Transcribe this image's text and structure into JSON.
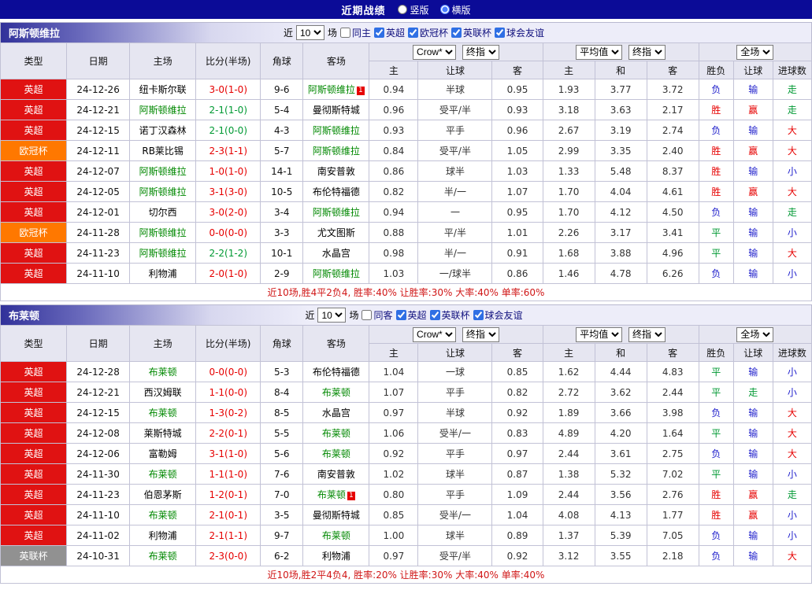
{
  "topbar": {
    "title": "近期战绩",
    "radios": [
      {
        "label": "竖版",
        "checked": false
      },
      {
        "label": "横版",
        "checked": true
      }
    ]
  },
  "palette": {
    "red": "#e60000",
    "green": "#009933",
    "blue": "#2121cc",
    "featured_team": "#008800",
    "league": {
      "英超": "#e01212",
      "欧冠杯": "#ff7800",
      "英联杯": "#919191"
    }
  },
  "red_card_badge": "1",
  "sections": [
    {
      "team": "阿斯顿维拉",
      "filter": {
        "prefix": "近",
        "count": "10",
        "suffix": "场",
        "checkboxes": [
          {
            "label": "同主",
            "checked": false
          },
          {
            "label": "英超",
            "checked": true
          },
          {
            "label": "欧冠杯",
            "checked": true
          },
          {
            "label": "英联杯",
            "checked": true
          },
          {
            "label": "球会友谊",
            "checked": true
          }
        ]
      },
      "header": {
        "cols": [
          "类型",
          "日期",
          "主场",
          "比分(半场)",
          "角球",
          "客场"
        ],
        "odds_select": "Crow*",
        "odds_stage_select": "终指",
        "odds_subcols": [
          "主",
          "让球",
          "客"
        ],
        "avg_select": "平均值",
        "avg_stage_select": "终指",
        "avg_subcols": [
          "主",
          "和",
          "客"
        ],
        "result_select": "全场",
        "result_subcols": [
          "胜负",
          "让球",
          "进球数"
        ]
      },
      "rows": [
        {
          "league": "英超",
          "date": "24-12-26",
          "home": "纽卡斯尔联",
          "score": "3-0(1-0)",
          "score_color": "red",
          "corners": "9-6",
          "away": "阿斯顿维拉",
          "away_featured": true,
          "away_red_card": true,
          "odds_home": "0.94",
          "handicap": "半球",
          "odds_away": "0.95",
          "avg_home": "1.93",
          "avg_draw": "3.77",
          "avg_away": "3.72",
          "result": "负",
          "result_color": "blue",
          "handicap_result": "输",
          "handicap_result_color": "blue",
          "goals": "走",
          "goals_color": "green"
        },
        {
          "league": "英超",
          "date": "24-12-21",
          "home": "阿斯顿维拉",
          "home_featured": true,
          "score": "2-1(1-0)",
          "score_color": "green",
          "corners": "5-4",
          "away": "曼彻斯特城",
          "odds_home": "0.96",
          "handicap": "受平/半",
          "odds_away": "0.93",
          "avg_home": "3.18",
          "avg_draw": "3.63",
          "avg_away": "2.17",
          "result": "胜",
          "result_color": "red",
          "handicap_result": "赢",
          "handicap_result_color": "red",
          "goals": "走",
          "goals_color": "green"
        },
        {
          "league": "英超",
          "date": "24-12-15",
          "home": "诺丁汉森林",
          "score": "2-1(0-0)",
          "score_color": "green",
          "corners": "4-3",
          "away": "阿斯顿维拉",
          "away_featured": true,
          "odds_home": "0.93",
          "handicap": "平手",
          "odds_away": "0.96",
          "avg_home": "2.67",
          "avg_draw": "3.19",
          "avg_away": "2.74",
          "result": "负",
          "result_color": "blue",
          "handicap_result": "输",
          "handicap_result_color": "blue",
          "goals": "大",
          "goals_color": "red"
        },
        {
          "league": "欧冠杯",
          "date": "24-12-11",
          "home": "RB莱比锡",
          "score": "2-3(1-1)",
          "score_color": "red",
          "corners": "5-7",
          "away": "阿斯顿维拉",
          "away_featured": true,
          "odds_home": "0.84",
          "handicap": "受平/半",
          "odds_away": "1.05",
          "avg_home": "2.99",
          "avg_draw": "3.35",
          "avg_away": "2.40",
          "result": "胜",
          "result_color": "red",
          "handicap_result": "赢",
          "handicap_result_color": "red",
          "goals": "大",
          "goals_color": "red"
        },
        {
          "league": "英超",
          "date": "24-12-07",
          "home": "阿斯顿维拉",
          "home_featured": true,
          "score": "1-0(1-0)",
          "score_color": "red",
          "corners": "14-1",
          "away": "南安普敦",
          "odds_home": "0.86",
          "handicap": "球半",
          "odds_away": "1.03",
          "avg_home": "1.33",
          "avg_draw": "5.48",
          "avg_away": "8.37",
          "result": "胜",
          "result_color": "red",
          "handicap_result": "输",
          "handicap_result_color": "blue",
          "goals": "小",
          "goals_color": "blue"
        },
        {
          "league": "英超",
          "date": "24-12-05",
          "home": "阿斯顿维拉",
          "home_featured": true,
          "score": "3-1(3-0)",
          "score_color": "red",
          "corners": "10-5",
          "away": "布伦特福德",
          "odds_home": "0.82",
          "handicap": "半/一",
          "odds_away": "1.07",
          "avg_home": "1.70",
          "avg_draw": "4.04",
          "avg_away": "4.61",
          "result": "胜",
          "result_color": "red",
          "handicap_result": "赢",
          "handicap_result_color": "red",
          "goals": "大",
          "goals_color": "red"
        },
        {
          "league": "英超",
          "date": "24-12-01",
          "home": "切尔西",
          "score": "3-0(2-0)",
          "score_color": "red",
          "corners": "3-4",
          "away": "阿斯顿维拉",
          "away_featured": true,
          "odds_home": "0.94",
          "handicap": "一",
          "odds_away": "0.95",
          "avg_home": "1.70",
          "avg_draw": "4.12",
          "avg_away": "4.50",
          "result": "负",
          "result_color": "blue",
          "handicap_result": "输",
          "handicap_result_color": "blue",
          "goals": "走",
          "goals_color": "green"
        },
        {
          "league": "欧冠杯",
          "date": "24-11-28",
          "home": "阿斯顿维拉",
          "home_featured": true,
          "score": "0-0(0-0)",
          "score_color": "red",
          "corners": "3-3",
          "away": "尤文图斯",
          "odds_home": "0.88",
          "handicap": "平/半",
          "odds_away": "1.01",
          "avg_home": "2.26",
          "avg_draw": "3.17",
          "avg_away": "3.41",
          "result": "平",
          "result_color": "green",
          "handicap_result": "输",
          "handicap_result_color": "blue",
          "goals": "小",
          "goals_color": "blue"
        },
        {
          "league": "英超",
          "date": "24-11-23",
          "home": "阿斯顿维拉",
          "home_featured": true,
          "score": "2-2(1-2)",
          "score_color": "green",
          "corners": "10-1",
          "away": "水晶宫",
          "odds_home": "0.98",
          "handicap": "半/一",
          "odds_away": "0.91",
          "avg_home": "1.68",
          "avg_draw": "3.88",
          "avg_away": "4.96",
          "result": "平",
          "result_color": "green",
          "handicap_result": "输",
          "handicap_result_color": "blue",
          "goals": "大",
          "goals_color": "red"
        },
        {
          "league": "英超",
          "date": "24-11-10",
          "home": "利物浦",
          "score": "2-0(1-0)",
          "score_color": "red",
          "corners": "2-9",
          "away": "阿斯顿维拉",
          "away_featured": true,
          "odds_home": "1.03",
          "handicap": "一/球半",
          "odds_away": "0.86",
          "avg_home": "1.46",
          "avg_draw": "4.78",
          "avg_away": "6.26",
          "result": "负",
          "result_color": "blue",
          "handicap_result": "输",
          "handicap_result_color": "blue",
          "goals": "小",
          "goals_color": "blue"
        }
      ],
      "summary": "近10场,胜4平2负4, 胜率:40% 让胜率:30% 大率:40% 单率:60%"
    },
    {
      "team": "布莱顿",
      "filter": {
        "prefix": "近",
        "count": "10",
        "suffix": "场",
        "checkboxes": [
          {
            "label": "同客",
            "checked": false
          },
          {
            "label": "英超",
            "checked": true
          },
          {
            "label": "英联杯",
            "checked": true
          },
          {
            "label": "球会友谊",
            "checked": true
          }
        ]
      },
      "header": {
        "cols": [
          "类型",
          "日期",
          "主场",
          "比分(半场)",
          "角球",
          "客场"
        ],
        "odds_select": "Crow*",
        "odds_stage_select": "终指",
        "odds_subcols": [
          "主",
          "让球",
          "客"
        ],
        "avg_select": "平均值",
        "avg_stage_select": "终指",
        "avg_subcols": [
          "主",
          "和",
          "客"
        ],
        "result_select": "全场",
        "result_subcols": [
          "胜负",
          "让球",
          "进球数"
        ]
      },
      "rows": [
        {
          "league": "英超",
          "date": "24-12-28",
          "home": "布莱顿",
          "home_featured": true,
          "score": "0-0(0-0)",
          "score_color": "red",
          "corners": "5-3",
          "away": "布伦特福德",
          "odds_home": "1.04",
          "handicap": "一球",
          "odds_away": "0.85",
          "avg_home": "1.62",
          "avg_draw": "4.44",
          "avg_away": "4.83",
          "result": "平",
          "result_color": "green",
          "handicap_result": "输",
          "handicap_result_color": "blue",
          "goals": "小",
          "goals_color": "blue"
        },
        {
          "league": "英超",
          "date": "24-12-21",
          "home": "西汉姆联",
          "score": "1-1(0-0)",
          "score_color": "red",
          "corners": "8-4",
          "away": "布莱顿",
          "away_featured": true,
          "odds_home": "1.07",
          "handicap": "平手",
          "odds_away": "0.82",
          "avg_home": "2.72",
          "avg_draw": "3.62",
          "avg_away": "2.44",
          "result": "平",
          "result_color": "green",
          "handicap_result": "走",
          "handicap_result_color": "green",
          "goals": "小",
          "goals_color": "blue"
        },
        {
          "league": "英超",
          "date": "24-12-15",
          "home": "布莱顿",
          "home_featured": true,
          "score": "1-3(0-2)",
          "score_color": "red",
          "corners": "8-5",
          "away": "水晶宫",
          "odds_home": "0.97",
          "handicap": "半球",
          "odds_away": "0.92",
          "avg_home": "1.89",
          "avg_draw": "3.66",
          "avg_away": "3.98",
          "result": "负",
          "result_color": "blue",
          "handicap_result": "输",
          "handicap_result_color": "blue",
          "goals": "大",
          "goals_color": "red"
        },
        {
          "league": "英超",
          "date": "24-12-08",
          "home": "莱斯特城",
          "score": "2-2(0-1)",
          "score_color": "red",
          "corners": "5-5",
          "away": "布莱顿",
          "away_featured": true,
          "odds_home": "1.06",
          "handicap": "受半/一",
          "odds_away": "0.83",
          "avg_home": "4.89",
          "avg_draw": "4.20",
          "avg_away": "1.64",
          "result": "平",
          "result_color": "green",
          "handicap_result": "输",
          "handicap_result_color": "blue",
          "goals": "大",
          "goals_color": "red"
        },
        {
          "league": "英超",
          "date": "24-12-06",
          "home": "富勒姆",
          "score": "3-1(1-0)",
          "score_color": "red",
          "corners": "5-6",
          "away": "布莱顿",
          "away_featured": true,
          "odds_home": "0.92",
          "handicap": "平手",
          "odds_away": "0.97",
          "avg_home": "2.44",
          "avg_draw": "3.61",
          "avg_away": "2.75",
          "result": "负",
          "result_color": "blue",
          "handicap_result": "输",
          "handicap_result_color": "blue",
          "goals": "大",
          "goals_color": "red"
        },
        {
          "league": "英超",
          "date": "24-11-30",
          "home": "布莱顿",
          "home_featured": true,
          "score": "1-1(1-0)",
          "score_color": "red",
          "corners": "7-6",
          "away": "南安普敦",
          "odds_home": "1.02",
          "handicap": "球半",
          "odds_away": "0.87",
          "avg_home": "1.38",
          "avg_draw": "5.32",
          "avg_away": "7.02",
          "result": "平",
          "result_color": "green",
          "handicap_result": "输",
          "handicap_result_color": "blue",
          "goals": "小",
          "goals_color": "blue"
        },
        {
          "league": "英超",
          "date": "24-11-23",
          "home": "伯恩茅斯",
          "score": "1-2(0-1)",
          "score_color": "red",
          "corners": "7-0",
          "away": "布莱顿",
          "away_featured": true,
          "away_red_card": true,
          "odds_home": "0.80",
          "handicap": "平手",
          "odds_away": "1.09",
          "avg_home": "2.44",
          "avg_draw": "3.56",
          "avg_away": "2.76",
          "result": "胜",
          "result_color": "red",
          "handicap_result": "赢",
          "handicap_result_color": "red",
          "goals": "走",
          "goals_color": "green"
        },
        {
          "league": "英超",
          "date": "24-11-10",
          "home": "布莱顿",
          "home_featured": true,
          "score": "2-1(0-1)",
          "score_color": "red",
          "corners": "3-5",
          "away": "曼彻斯特城",
          "odds_home": "0.85",
          "handicap": "受半/一",
          "odds_away": "1.04",
          "avg_home": "4.08",
          "avg_draw": "4.13",
          "avg_away": "1.77",
          "result": "胜",
          "result_color": "red",
          "handicap_result": "赢",
          "handicap_result_color": "red",
          "goals": "小",
          "goals_color": "blue"
        },
        {
          "league": "英超",
          "date": "24-11-02",
          "home": "利物浦",
          "score": "2-1(1-1)",
          "score_color": "red",
          "corners": "9-7",
          "away": "布莱顿",
          "away_featured": true,
          "odds_home": "1.00",
          "handicap": "球半",
          "odds_away": "0.89",
          "avg_home": "1.37",
          "avg_draw": "5.39",
          "avg_away": "7.05",
          "result": "负",
          "result_color": "blue",
          "handicap_result": "输",
          "handicap_result_color": "blue",
          "goals": "小",
          "goals_color": "blue"
        },
        {
          "league": "英联杯",
          "date": "24-10-31",
          "home": "布莱顿",
          "home_featured": true,
          "score": "2-3(0-0)",
          "score_color": "red",
          "corners": "6-2",
          "away": "利物浦",
          "odds_home": "0.97",
          "handicap": "受平/半",
          "odds_away": "0.92",
          "avg_home": "3.12",
          "avg_draw": "3.55",
          "avg_away": "2.18",
          "result": "负",
          "result_color": "blue",
          "handicap_result": "输",
          "handicap_result_color": "blue",
          "goals": "大",
          "goals_color": "red"
        }
      ],
      "summary": "近10场,胜2平4负4, 胜率:20% 让胜率:30% 大率:40% 单率:40%"
    }
  ]
}
